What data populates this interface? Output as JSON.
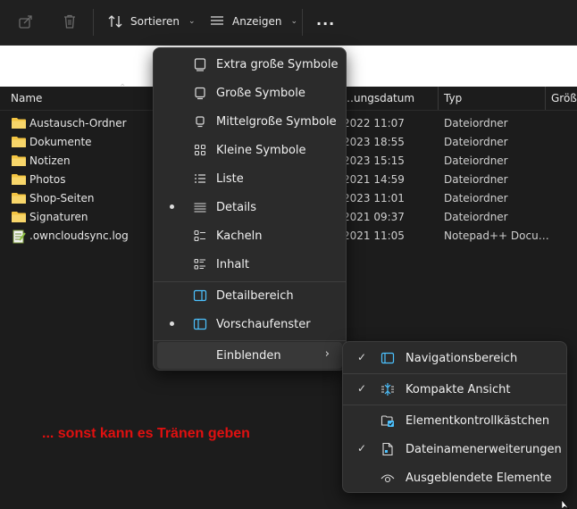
{
  "toolbar": {
    "sort_label": "Sortieren",
    "view_label": "Anzeigen",
    "more_label": "..."
  },
  "columns": {
    "name": "Name",
    "date": "…ungsdatum",
    "type": "Typ",
    "size": "Größe"
  },
  "files": [
    {
      "name": "Austausch-Ordner",
      "date": "2022 11:07",
      "type": "Dateiordner",
      "icon": "folder-icon"
    },
    {
      "name": "Dokumente",
      "date": "2023 18:55",
      "type": "Dateiordner",
      "icon": "folder-icon"
    },
    {
      "name": "Notizen",
      "date": "2023 15:15",
      "type": "Dateiordner",
      "icon": "folder-icon"
    },
    {
      "name": "Photos",
      "date": "2021 14:59",
      "type": "Dateiordner",
      "icon": "folder-icon"
    },
    {
      "name": "Shop-Seiten",
      "date": "2023 11:01",
      "type": "Dateiordner",
      "icon": "folder-icon"
    },
    {
      "name": "Signaturen",
      "date": "2021 09:37",
      "type": "Dateiordner",
      "icon": "folder-icon"
    },
    {
      "name": ".owncloudsync.log",
      "date": "2021 11:05",
      "type": "Notepad++ Docu…",
      "icon": "notepad-file-icon"
    }
  ],
  "view_menu": {
    "items": [
      {
        "label": "Extra große Symbole",
        "selected": false
      },
      {
        "label": "Große Symbole",
        "selected": false
      },
      {
        "label": "Mittelgroße Symbole",
        "selected": false
      },
      {
        "label": "Kleine Symbole",
        "selected": false
      },
      {
        "label": "Liste",
        "selected": false
      },
      {
        "label": "Details",
        "selected": true
      },
      {
        "label": "Kacheln",
        "selected": false
      },
      {
        "label": "Inhalt",
        "selected": false
      }
    ],
    "panes": [
      {
        "label": "Detailbereich",
        "selected": false
      },
      {
        "label": "Vorschaufenster",
        "selected": true
      }
    ],
    "show": {
      "label": "Einblenden"
    }
  },
  "show_menu": {
    "items": [
      {
        "label": "Navigationsbereich",
        "checked": true
      },
      {
        "label": "Kompakte Ansicht",
        "checked": true
      },
      {
        "label": "Elementkontrollkästchen",
        "checked": false
      },
      {
        "label": "Dateinamenerweiterungen",
        "checked": true
      },
      {
        "label": "Ausgeblendete Elemente",
        "checked": false
      }
    ]
  },
  "annotation": "... sonst kann es Tränen geben",
  "colors": {
    "accent": "#4cc2ff",
    "folder": "#f4c542",
    "annotation": "#e01010"
  }
}
